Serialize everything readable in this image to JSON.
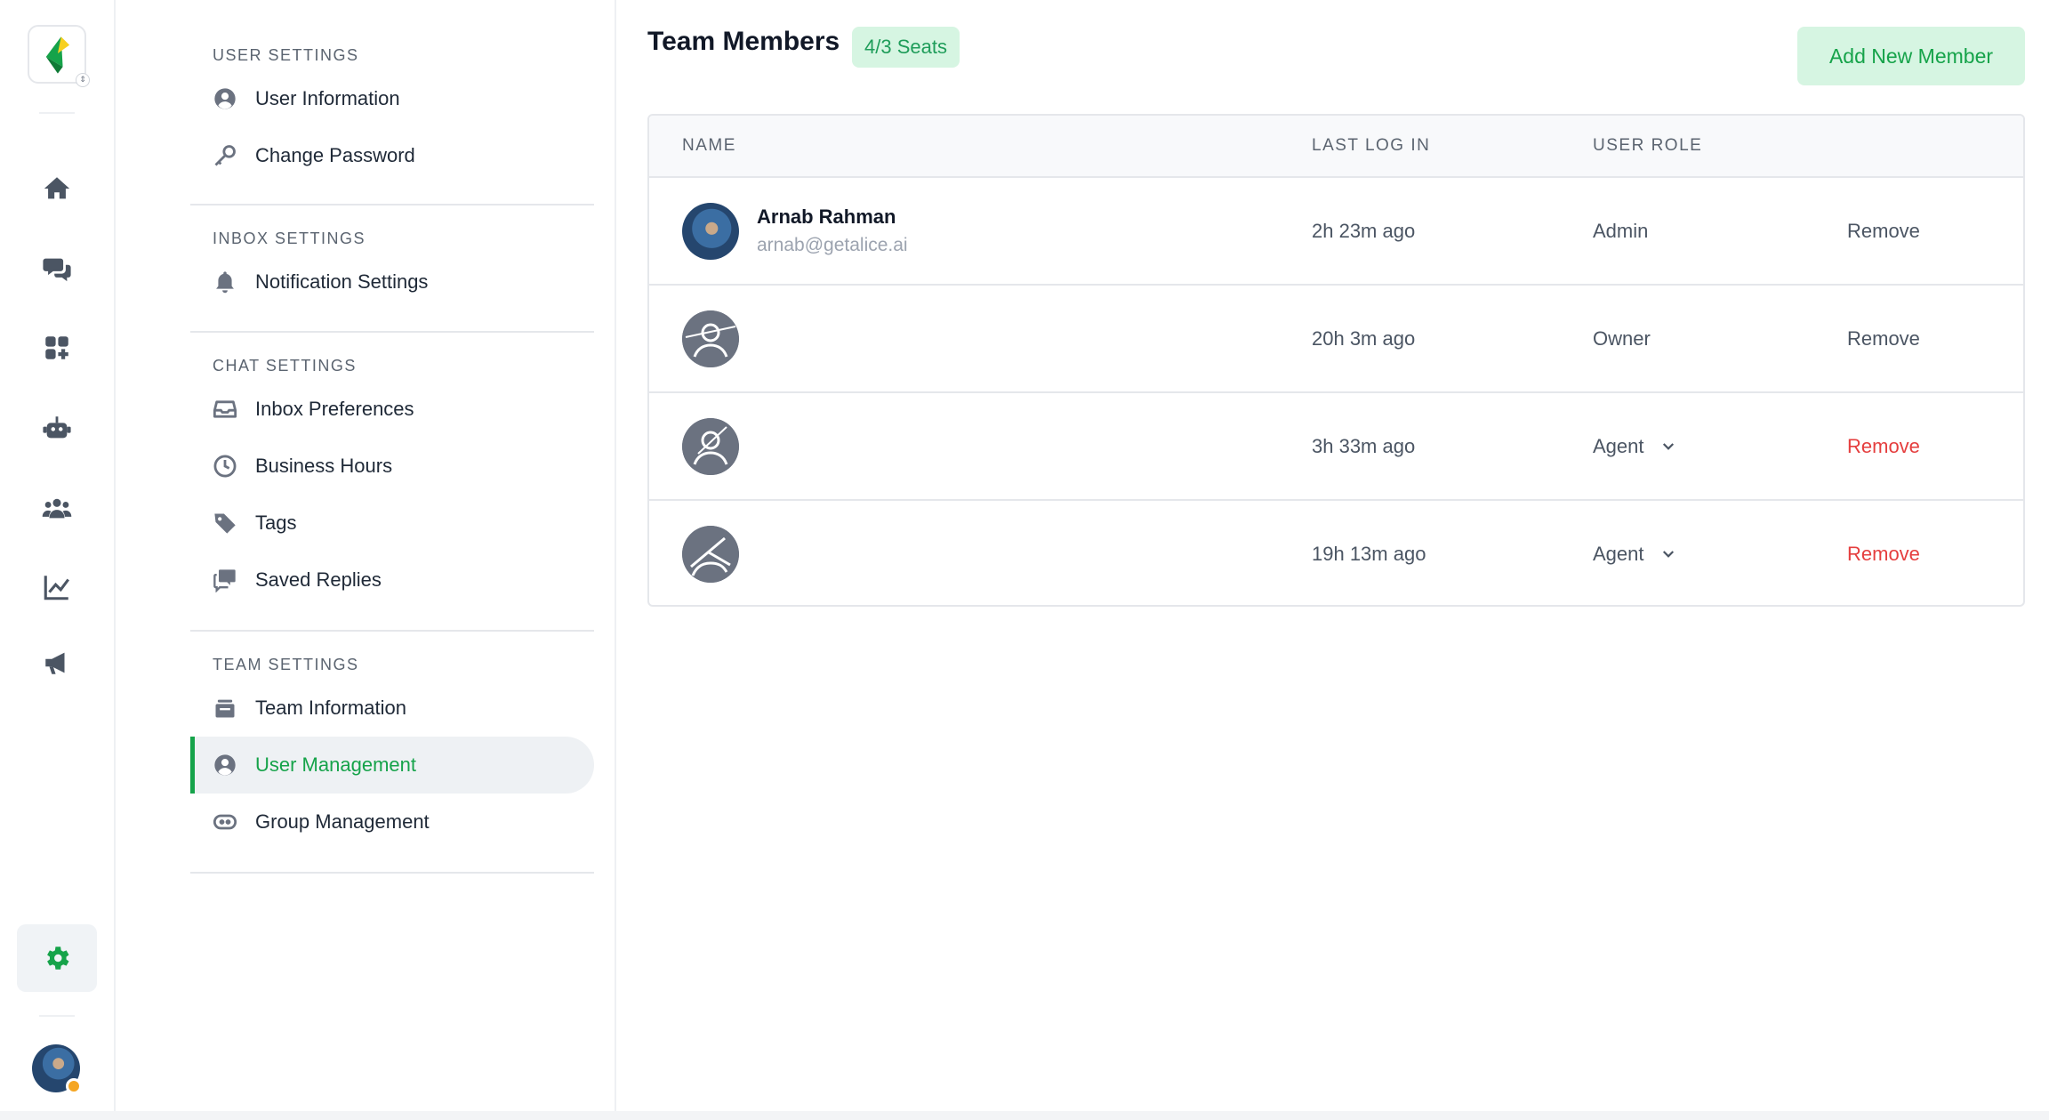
{
  "colors": {
    "accent": "#16a34a",
    "badge_bg": "#d6f5e2",
    "danger": "#e53e3e",
    "status_away": "#f5a623"
  },
  "rail": {
    "items": [
      {
        "icon": "home-icon"
      },
      {
        "icon": "chat-icon"
      },
      {
        "icon": "apps-icon"
      },
      {
        "icon": "bot-icon"
      },
      {
        "icon": "team-icon"
      },
      {
        "icon": "analytics-icon"
      },
      {
        "icon": "megaphone-icon"
      }
    ],
    "settings_icon": "gear-icon"
  },
  "menu": {
    "user_settings": {
      "heading": "USER SETTINGS",
      "items": [
        "User Information",
        "Change Password"
      ]
    },
    "inbox_settings": {
      "heading": "INBOX SETTINGS",
      "items": [
        "Notification Settings"
      ]
    },
    "chat_settings": {
      "heading": "CHAT SETTINGS",
      "items": [
        "Inbox Preferences",
        "Business Hours",
        "Tags",
        "Saved Replies"
      ]
    },
    "team_settings": {
      "heading": "TEAM SETTINGS",
      "items": [
        "Team Information",
        "User Management",
        "Group Management"
      ],
      "active": "User Management"
    }
  },
  "main": {
    "title": "Team Members",
    "seats": "4/3 Seats",
    "add_button": "Add New Member",
    "columns": [
      "NAME",
      "LAST LOG IN",
      "USER ROLE"
    ],
    "members": [
      {
        "name": "Arnab Rahman",
        "email": "arnab@getalice.ai",
        "last_login": "2h 23m ago",
        "role": "Admin",
        "role_editable": false,
        "remove": "Remove",
        "remove_active": false
      },
      {
        "name": "",
        "email": "",
        "last_login": "20h 3m ago",
        "role": "Owner",
        "role_editable": false,
        "remove": "Remove",
        "remove_active": false
      },
      {
        "name": "",
        "email": "",
        "last_login": "3h 33m ago",
        "role": "Agent",
        "role_editable": true,
        "remove": "Remove",
        "remove_active": true
      },
      {
        "name": "",
        "email": "",
        "last_login": "19h 13m ago",
        "role": "Agent",
        "role_editable": true,
        "remove": "Remove",
        "remove_active": true
      }
    ]
  }
}
